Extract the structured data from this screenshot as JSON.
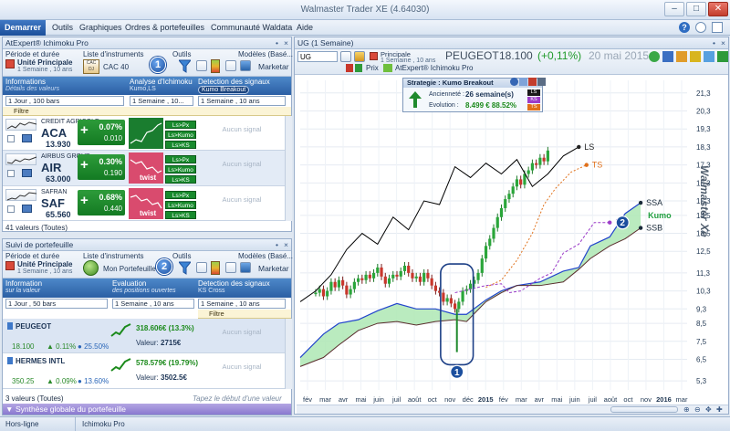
{
  "app": {
    "title": "Walmaster Trader XE",
    "version": "(4.64030)",
    "help": "?"
  },
  "menu": {
    "items": [
      "Demarrer",
      "Outils",
      "Graphiques",
      "Ordres & portefeuilles",
      "Communauté Waldata",
      "Aide"
    ]
  },
  "watchlist": {
    "panel_title": "AtExpert® Ichimoku Pro",
    "tool_labels": {
      "periode": "Période et durée",
      "liste": "Liste d'instruments",
      "outils": "Outils",
      "modeles": "Modèles (Basé...",
      "unite": "Unité Principale",
      "unite_sub": "1 Semaine , 10 ans",
      "index": "CAC 40",
      "mkt": "Marketar"
    },
    "columns": {
      "info": "Informations",
      "info_sub": "Détails des valeurs",
      "analyse": "Analyse d'Ichimoku",
      "analyse_sub": "Kumo,LS",
      "detection": "Detection des signaux",
      "detection_sub": "Kumo Breakout"
    },
    "selects": {
      "info": "1 Jour , 100 bars",
      "analyse": "1 Semaine , 10...",
      "detection": "1 Semaine , 10 ans"
    },
    "filter": "Filtre",
    "rows": [
      {
        "name": "CREDIT AGRICOLE",
        "code": "ACA",
        "price": "13.930",
        "perf": "0.07%",
        "change": "0.010",
        "signals": [
          "Ls>Px",
          "Ls>Kumo",
          "Ls>KS"
        ],
        "no_signal": "Aucun signal",
        "twist": ""
      },
      {
        "name": "AIRBUS GROUP",
        "code": "AIR",
        "price": "63.000",
        "perf": "0.30%",
        "change": "0.190",
        "signals": [
          "Ls>Px",
          "Ls>Kumo",
          "Ls>KS"
        ],
        "no_signal": "Aucun signal",
        "twist": "twist"
      },
      {
        "name": "SAFRAN",
        "code": "SAF",
        "price": "65.560",
        "perf": "0.68%",
        "change": "0.440",
        "signals": [
          "Ls>Px",
          "Ls>Kumo",
          "Ls>KS"
        ],
        "no_signal": "Aucun signal",
        "twist": "twist"
      }
    ],
    "count": "41 valeurs (Toutes)"
  },
  "portfolio": {
    "panel_title": "Suivi de portefeuille",
    "tool_labels": {
      "periode": "Période et durée",
      "liste": "Liste d'instruments",
      "outils": "Outils",
      "modeles": "Modèles (Basé...",
      "unite": "Unité Principale",
      "unite_sub": "1 Semaine , 10 ans",
      "portfolio": "Mon Portefeuille",
      "mkt": "Marketar"
    },
    "columns": {
      "info": "Information",
      "info_sub": "sur la valeur",
      "eval": "Evaluation",
      "eval_sub": "des positions ouvertes",
      "detection": "Detection des signaux",
      "detection_sub": "KS Cross"
    },
    "selects": {
      "info": "1 Jour , 50 bars",
      "eval": "1 Semaine , 10 ans",
      "detection": "1 Semaine , 10 ans"
    },
    "filter": "Filtre",
    "rows": [
      {
        "name": "PEUGEOT",
        "price": "18.100",
        "var": "0.11%",
        "perf": "25.50%",
        "gain": "318.606€ (13.3%)",
        "value_label": "Valeur:",
        "value": "2715€",
        "no_signal": "Aucun signal"
      },
      {
        "name": "HERMES INTL",
        "price": "350.25",
        "var": "0.09%",
        "perf": "13.60%",
        "gain": "578.579€ (19.79%)",
        "value_label": "Valeur:",
        "value": "3502.5€",
        "no_signal": "Aucun signal"
      }
    ],
    "count": "3 valeurs (Toutes)",
    "hint": "Tapez le début d'une valeur",
    "synthesis": "Synthèse globale du portefeuille"
  },
  "chart": {
    "panel_title": "UG (1 Semaine)",
    "symbol_input": "UG",
    "unit": "Principale",
    "unit_sub": "1 Semaine , 10 ans",
    "stock_name": "PEUGEOT",
    "price": "18.100",
    "change": "(+0,11%)",
    "date": "20 mai 2015",
    "tabs": [
      "Prix",
      "AtExpert® Ichimoku Pro"
    ],
    "strategy": {
      "title": "Strategie : Kumo Breakout",
      "age_label": "Ancienneté :",
      "age": "26 semaine(s)",
      "evo_label": "Evolution :",
      "evo": "8.499 € 88.52%",
      "tags": [
        "LS",
        "KS",
        "TS"
      ]
    },
    "watermark": "Walmaster Xe"
  },
  "chart_data": {
    "type": "line",
    "x_ticks": [
      "fév",
      "mar",
      "avr",
      "mai",
      "juin",
      "juil",
      "août",
      "oct",
      "nov",
      "déc",
      "2015",
      "fév",
      "mar",
      "avr",
      "mai",
      "juin",
      "juil",
      "août",
      "oct",
      "nov",
      "2016",
      "mar"
    ],
    "y_ticks": [
      5.3,
      6.5,
      7.5,
      8.5,
      9.3,
      10.3,
      11.3,
      12.5,
      13.5,
      14.5,
      15.3,
      16.3,
      17.3,
      18.3,
      19.3,
      20.3,
      21.3
    ],
    "ylim": [
      4.8,
      22
    ],
    "series": [
      {
        "name": "LS",
        "color": "#000000"
      },
      {
        "name": "TS",
        "color": "#e0701a"
      },
      {
        "name": "KS",
        "color": "#9c3cc8"
      },
      {
        "name": "SSA",
        "color": "#2244cc"
      },
      {
        "name": "SSB",
        "color": "#5a2d2d"
      },
      {
        "name": "Kumo",
        "color": "#22a040"
      }
    ],
    "annotations": [
      "1",
      "2"
    ],
    "ls": [
      [
        0,
        9.7
      ],
      [
        4,
        10.3
      ],
      [
        8,
        11.2
      ],
      [
        12,
        12.6
      ],
      [
        16,
        13.5
      ],
      [
        20,
        12.9
      ],
      [
        24,
        14.4
      ],
      [
        28,
        13.7
      ],
      [
        32,
        15.3
      ],
      [
        36,
        15.1
      ],
      [
        40,
        17.2
      ],
      [
        44,
        16.6
      ],
      [
        48,
        17.4
      ],
      [
        52,
        16.8
      ],
      [
        56,
        17.6
      ],
      [
        60,
        16.1
      ],
      [
        64,
        16.8
      ],
      [
        68,
        17.8
      ],
      [
        72,
        18.3
      ]
    ],
    "ks": [
      [
        40,
        10.2
      ],
      [
        44,
        10.4
      ],
      [
        48,
        10.6
      ],
      [
        52,
        10.7
      ],
      [
        54,
        10.2
      ],
      [
        57,
        10.3
      ],
      [
        62,
        11.0
      ],
      [
        65,
        11.3
      ],
      [
        68,
        12.4
      ],
      [
        72,
        12.9
      ],
      [
        76,
        14.1
      ],
      [
        80,
        14.1
      ]
    ],
    "ts": [
      [
        48,
        10.5
      ],
      [
        52,
        10.9
      ],
      [
        56,
        12.0
      ],
      [
        60,
        13.5
      ],
      [
        63,
        15.1
      ],
      [
        66,
        16.0
      ],
      [
        70,
        16.9
      ],
      [
        74,
        17.3
      ]
    ],
    "ssa": [
      [
        0,
        6.6
      ],
      [
        6,
        7.9
      ],
      [
        10,
        8.5
      ],
      [
        15,
        8.7
      ],
      [
        20,
        9.2
      ],
      [
        25,
        9.6
      ],
      [
        30,
        9.3
      ],
      [
        35,
        9.3
      ],
      [
        40,
        9.0
      ],
      [
        43,
        9.0
      ],
      [
        48,
        9.8
      ],
      [
        52,
        10.3
      ],
      [
        56,
        10.6
      ],
      [
        62,
        10.8
      ],
      [
        68,
        11.4
      ],
      [
        72,
        11.6
      ],
      [
        75,
        12.8
      ],
      [
        80,
        13.3
      ],
      [
        84,
        14.6
      ],
      [
        88,
        15.2
      ]
    ],
    "ssb": [
      [
        0,
        6.1
      ],
      [
        6,
        6.6
      ],
      [
        10,
        7.3
      ],
      [
        15,
        8.1
      ],
      [
        20,
        8.5
      ],
      [
        25,
        8.6
      ],
      [
        30,
        8.4
      ],
      [
        35,
        8.6
      ],
      [
        40,
        8.7
      ],
      [
        43,
        8.6
      ],
      [
        48,
        9.7
      ],
      [
        52,
        10.2
      ],
      [
        56,
        10.6
      ],
      [
        62,
        10.6
      ],
      [
        68,
        10.8
      ],
      [
        72,
        11.5
      ],
      [
        75,
        12.1
      ],
      [
        80,
        12.8
      ],
      [
        84,
        13.2
      ],
      [
        88,
        13.8
      ]
    ],
    "candles": [
      [
        4,
        10.2
      ],
      [
        5,
        10.4
      ],
      [
        6,
        10.0
      ],
      [
        7,
        10.3
      ],
      [
        8,
        10.8
      ],
      [
        9,
        10.5
      ],
      [
        10,
        10.9
      ],
      [
        11,
        10.6
      ],
      [
        12,
        10.1
      ],
      [
        13,
        10.4
      ],
      [
        14,
        10.8
      ],
      [
        15,
        11.0
      ],
      [
        16,
        10.9
      ],
      [
        17,
        11.2
      ],
      [
        18,
        11.0
      ],
      [
        19,
        11.3
      ],
      [
        20,
        11.6
      ],
      [
        21,
        11.1
      ],
      [
        22,
        10.7
      ],
      [
        23,
        11.0
      ],
      [
        24,
        11.2
      ],
      [
        25,
        11.1
      ],
      [
        26,
        11.4
      ],
      [
        27,
        11.7
      ],
      [
        28,
        11.3
      ],
      [
        29,
        11.0
      ],
      [
        30,
        11.1
      ],
      [
        31,
        10.8
      ],
      [
        32,
        11.3
      ],
      [
        33,
        11.0
      ],
      [
        34,
        10.6
      ],
      [
        35,
        10.3
      ],
      [
        36,
        10.2
      ],
      [
        37,
        9.7
      ],
      [
        38,
        9.9
      ],
      [
        39,
        9.6
      ],
      [
        40,
        9.3
      ],
      [
        41,
        9.7
      ],
      [
        42,
        10.3
      ],
      [
        43,
        10.4
      ],
      [
        44,
        10.7
      ],
      [
        45,
        10.9
      ],
      [
        46,
        11.3
      ],
      [
        47,
        12.1
      ],
      [
        48,
        12.8
      ],
      [
        49,
        13.2
      ],
      [
        50,
        13.8
      ],
      [
        51,
        14.4
      ],
      [
        52,
        14.9
      ],
      [
        53,
        15.4
      ],
      [
        54,
        15.7
      ],
      [
        55,
        16.1
      ],
      [
        56,
        16.5
      ],
      [
        57,
        16.2
      ],
      [
        58,
        16.8
      ],
      [
        59,
        17.0
      ],
      [
        60,
        17.4
      ],
      [
        61,
        17.3
      ],
      [
        62,
        17.7
      ],
      [
        63,
        17.5
      ],
      [
        64,
        18.1
      ]
    ]
  }
}
